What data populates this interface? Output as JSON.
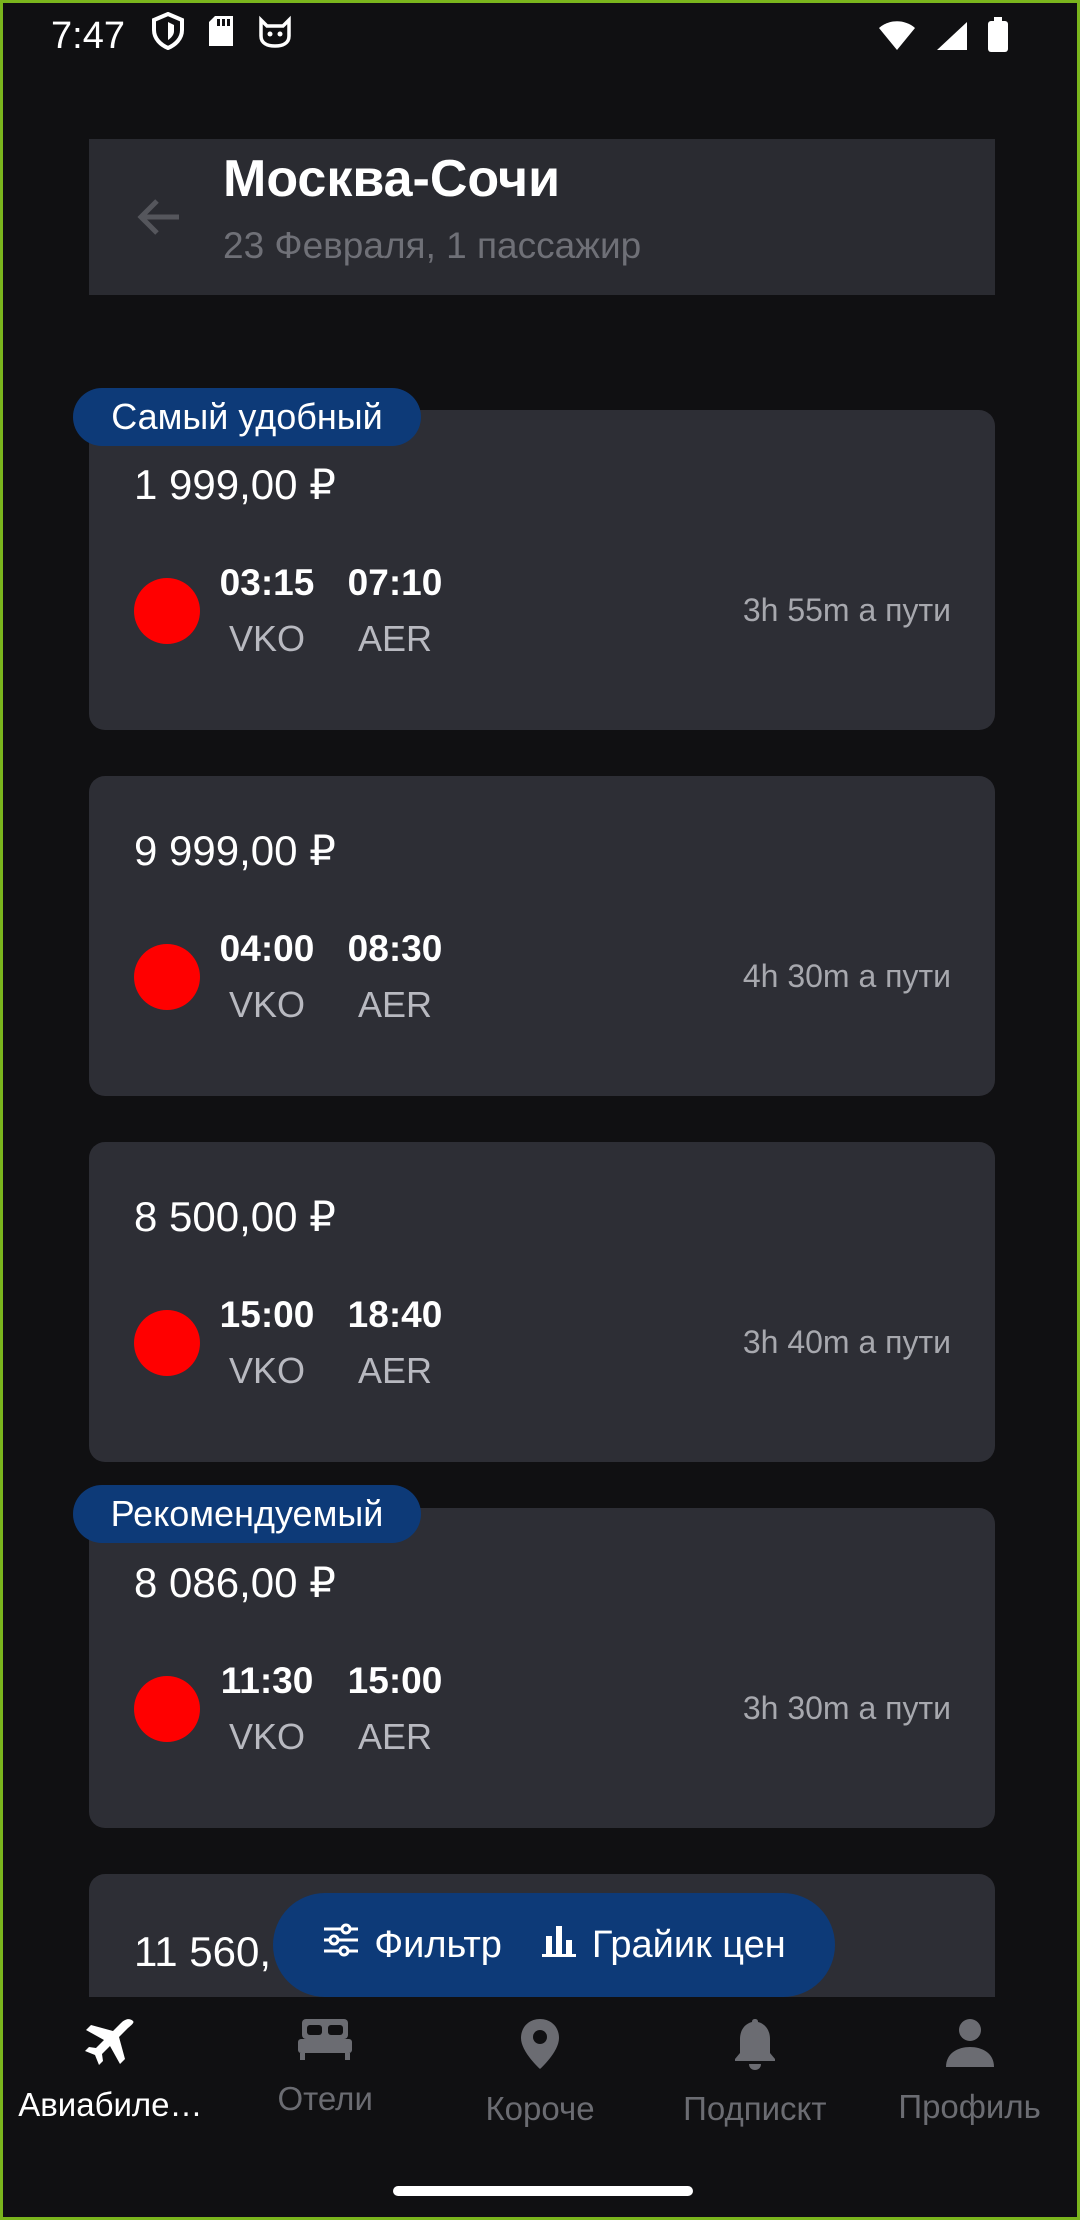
{
  "status": {
    "time": "7:47"
  },
  "header": {
    "title": "Москва-Сочи",
    "subtitle": "23 Февраля,  1 пассажир"
  },
  "flights": [
    {
      "badge": "Самый удобный",
      "price": "1 999,00 ₽",
      "dep_time": "03:15",
      "dep_code": "VKO",
      "arr_time": "07:10",
      "arr_code": "AER",
      "duration": "3h 55m а пути"
    },
    {
      "price": "9 999,00 ₽",
      "dep_time": "04:00",
      "dep_code": "VKO",
      "arr_time": "08:30",
      "arr_code": "AER",
      "duration": "4h 30m а пути"
    },
    {
      "price": "8 500,00 ₽",
      "dep_time": "15:00",
      "dep_code": "VKO",
      "arr_time": "18:40",
      "arr_code": "AER",
      "duration": "3h 40m а пути"
    },
    {
      "badge": "Рекомендуемый",
      "price": "8 086,00 ₽",
      "dep_time": "11:30",
      "dep_code": "VKO",
      "arr_time": "15:00",
      "arr_code": "AER",
      "duration": "3h 30m а пути"
    },
    {
      "price": "11 560,"
    }
  ],
  "fab": {
    "filter_label": "Фильтр",
    "chart_label": "Грайик цен"
  },
  "nav": [
    {
      "label": "Авиабиле…",
      "icon": "airplane-icon"
    },
    {
      "label": "Отели",
      "icon": "bed-icon"
    },
    {
      "label": "Короче",
      "icon": "location-pin-icon"
    },
    {
      "label": "Подпискт",
      "icon": "bell-icon"
    },
    {
      "label": "Профиль",
      "icon": "person-icon"
    }
  ],
  "colors": {
    "background": "#101012",
    "card": "#2d2e35",
    "accent": "#0d3a78",
    "airline_logo": "#ff0000"
  }
}
